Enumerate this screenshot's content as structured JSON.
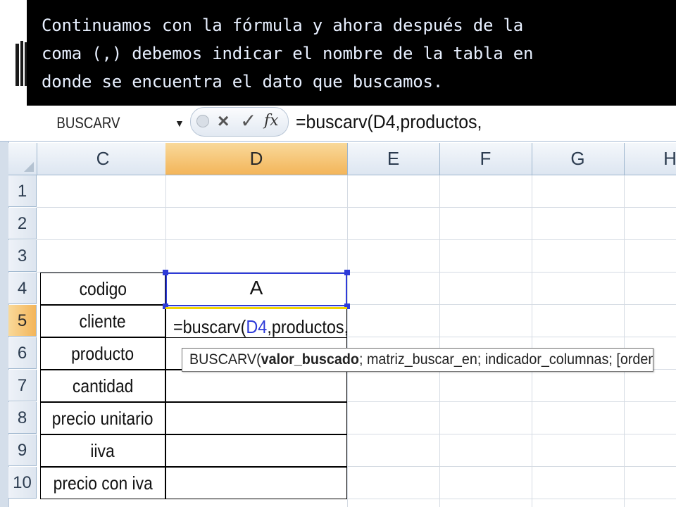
{
  "caption": {
    "text": "Continuamos con la fórmula y ahora después de la\ncoma (,) debemos indicar el nombre de la tabla en\ndonde se encuentra el dato que buscamos."
  },
  "formula_bar": {
    "name_box": "BUSCARV",
    "fx_label": "fx",
    "formula": "=buscarv(D4,productos,"
  },
  "columns": [
    "C",
    "D",
    "E",
    "F",
    "G",
    "H"
  ],
  "active_column": "D",
  "rows": [
    "1",
    "2",
    "3",
    "4",
    "5",
    "6",
    "7",
    "8",
    "9",
    "10"
  ],
  "active_row": "5",
  "table": {
    "labels": [
      "codigo",
      "cliente",
      "producto",
      "cantidad",
      "precio unitario",
      "iiva",
      "precio con iva"
    ],
    "d4_value": "A",
    "edit": {
      "prefix": "=buscarv(",
      "reference": "D4",
      "suffix": ",productos,"
    }
  },
  "tooltip": {
    "function": "BUSCARV(",
    "current_arg": "valor_buscado",
    "rest": "; matriz_buscar_en; indicador_columnas; [ordenado])"
  },
  "colors": {
    "caption_background": "#000000",
    "caption_text": "#e8f0ff",
    "active_header": "#f3b55a",
    "selection_border": "#2e3bd8",
    "reference_text": "#2e3bd8"
  }
}
